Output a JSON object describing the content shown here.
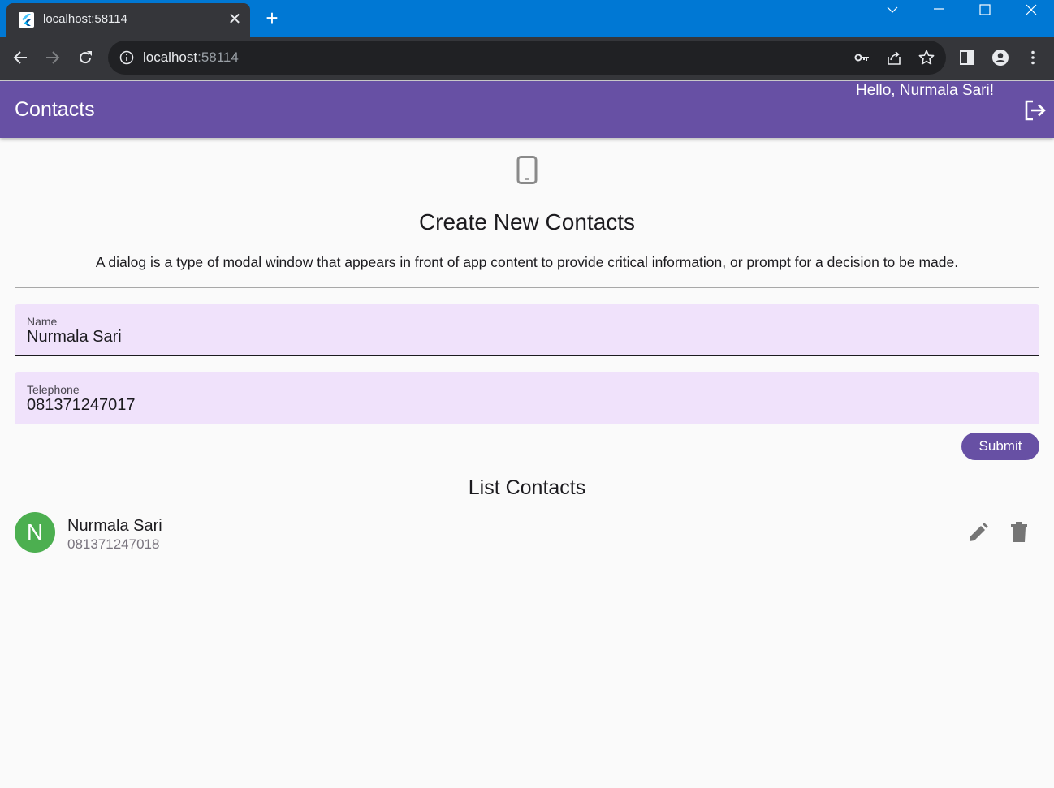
{
  "browser": {
    "tab_title": "localhost:58114",
    "url_host": "localhost",
    "url_port": ":58114"
  },
  "appbar": {
    "title": "Contacts",
    "greeting": "Hello, Nurmala Sari!"
  },
  "form": {
    "title": "Create New Contacts",
    "description": "A dialog is a type of modal window that appears in front of app content to provide critical information, or prompt for a decision to be made.",
    "name_label": "Name",
    "name_value": "Nurmala Sari",
    "telephone_label": "Telephone",
    "telephone_value": "081371247017",
    "submit_label": "Submit"
  },
  "list": {
    "title": "List Contacts",
    "items": [
      {
        "initial": "N",
        "name": "Nurmala Sari",
        "phone": "081371247018"
      }
    ]
  },
  "colors": {
    "primary": "#6750a4",
    "titlebar": "#0078d4",
    "field_fill": "#f0e2fb",
    "avatar": "#4caf50"
  },
  "icons": {
    "favicon": "flutter-icon",
    "phone": "smartphone-icon",
    "logout": "logout-icon",
    "edit": "pencil-icon",
    "delete": "trash-icon"
  }
}
